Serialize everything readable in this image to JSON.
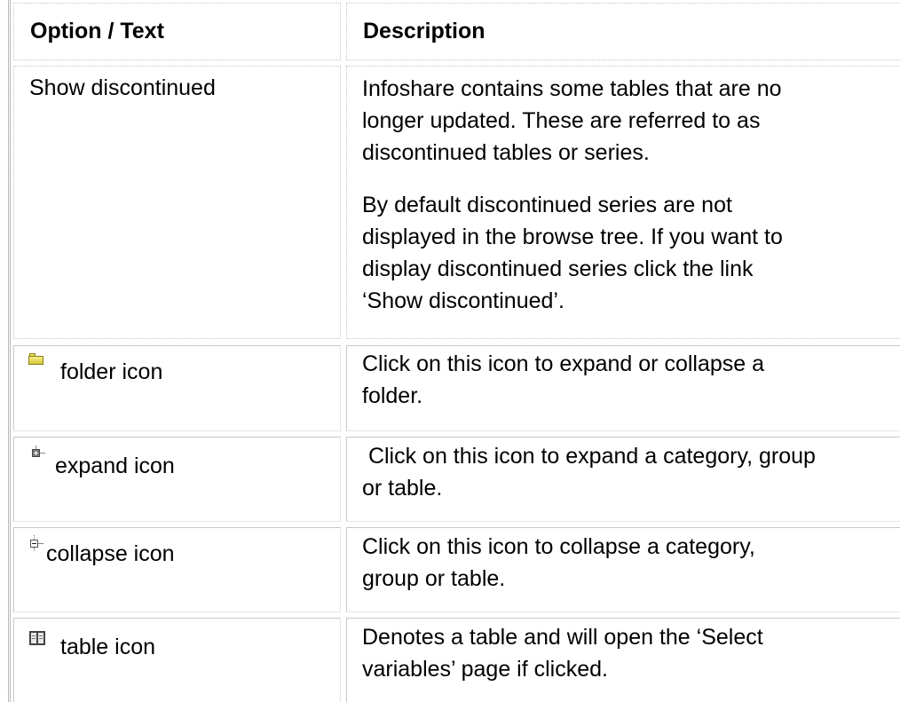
{
  "table": {
    "headers": {
      "option": "Option / Text",
      "description": "Description"
    },
    "rows": [
      {
        "option": "Show discontinued",
        "description": [
          "Infoshare contains some tables that are no",
          "longer updated. These are referred to as",
          "discontinued tables or series.",
          "By default discontinued series are not",
          "displayed in the browse tree. If you want to",
          "display discontinued series click the link",
          "‘Show discontinued’."
        ]
      },
      {
        "icon": "folder-icon",
        "option": "folder icon",
        "description": [
          "Click on this icon to expand or collapse a",
          "folder."
        ]
      },
      {
        "icon": "expand-icon",
        "option": "expand icon",
        "description": [
          " Click on this icon to expand a category, group",
          "or table."
        ]
      },
      {
        "icon": "collapse-icon",
        "option": "collapse icon",
        "description": [
          "Click on this icon to collapse a category,",
          "group or table."
        ]
      },
      {
        "icon": "table-icon",
        "option": "table icon",
        "description": [
          "Denotes a table and will open the ‘Select",
          "variables’ page if clicked."
        ]
      }
    ]
  }
}
